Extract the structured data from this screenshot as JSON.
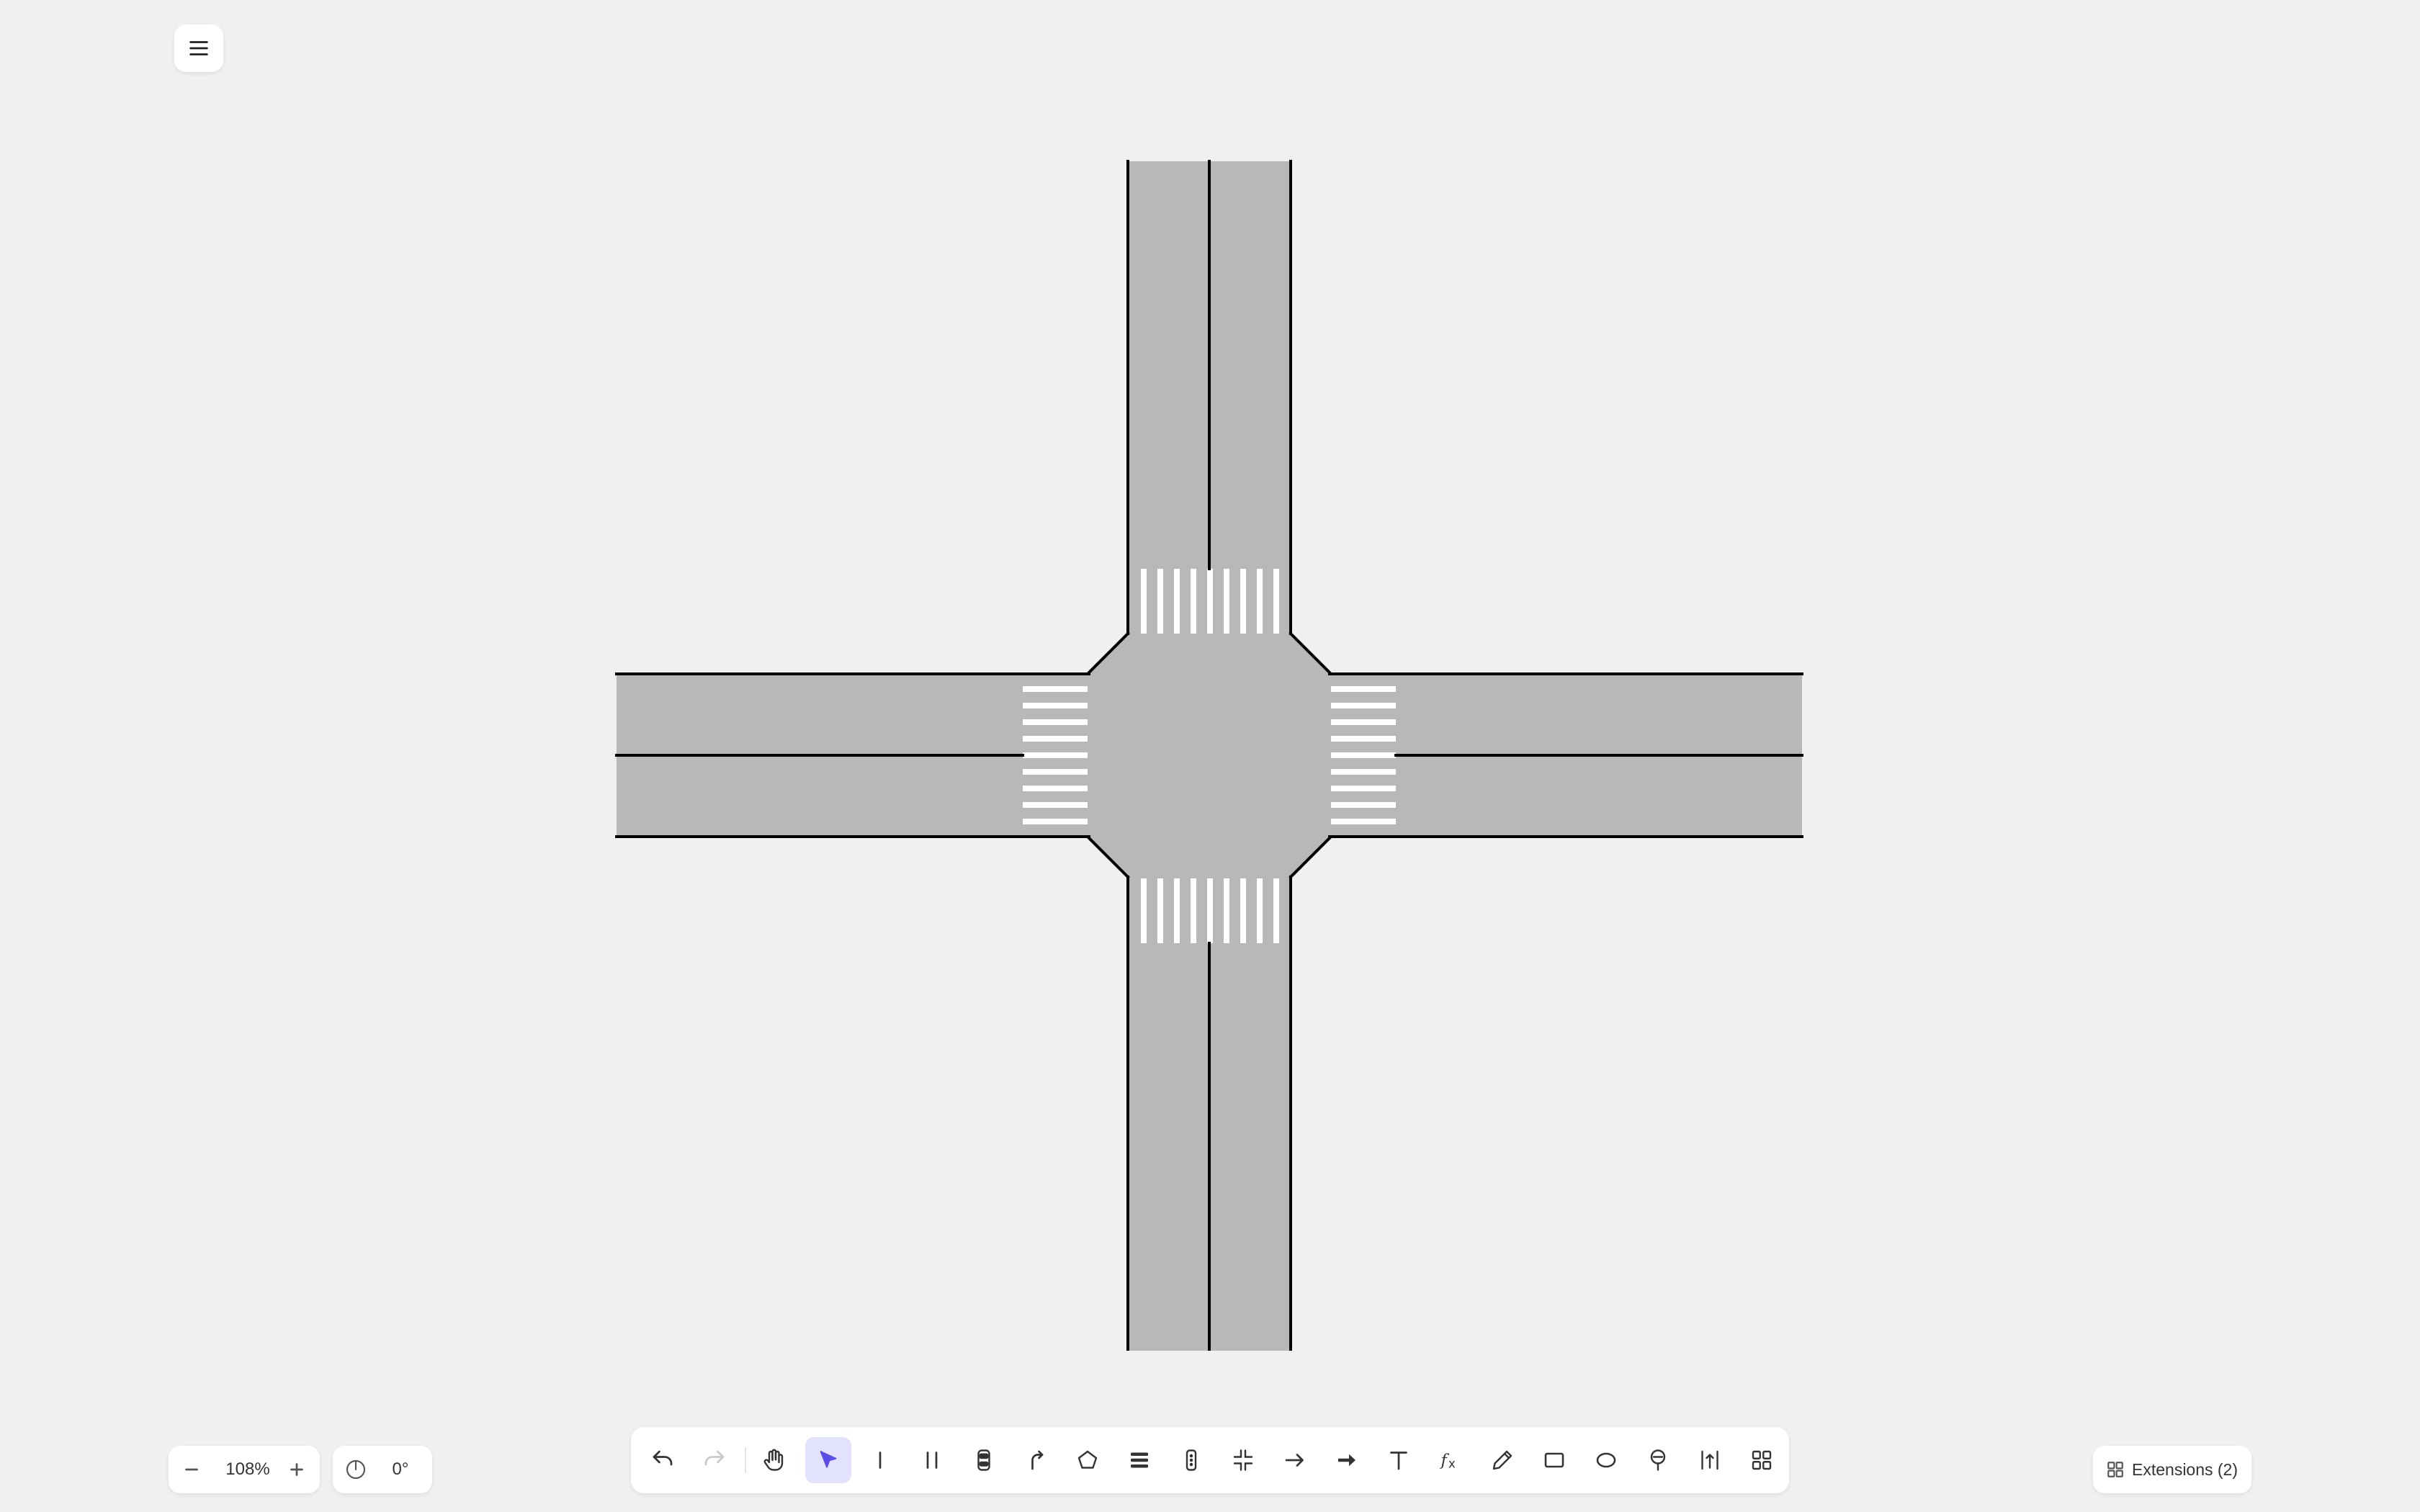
{
  "app": {
    "menu_icon": "hamburger-menu-icon"
  },
  "canvas": {
    "background": "#f0f0f0",
    "road_color": "#b8b8b8",
    "edge_color": "#000000",
    "crosswalk_color": "#ffffff",
    "scene": "four-way intersection with two-lane roads and zebra crosswalks on each approach"
  },
  "zoom": {
    "value": "108%",
    "zoom_out_icon": "minus-icon",
    "zoom_in_icon": "plus-icon"
  },
  "rotation": {
    "value": "0°",
    "icon": "compass-rotate-icon"
  },
  "toolbar": {
    "active_tool": "select",
    "accent": "#5b4ee6",
    "tools": [
      {
        "id": "undo",
        "icon": "undo-icon"
      },
      {
        "id": "redo",
        "icon": "redo-icon",
        "disabled": true
      },
      {
        "id": "hand",
        "icon": "hand-pan-icon"
      },
      {
        "id": "select",
        "icon": "select-arrow-icon"
      },
      {
        "id": "single-line-road",
        "icon": "single-line-road-icon"
      },
      {
        "id": "double-line-road",
        "icon": "double-line-road-icon"
      },
      {
        "id": "vehicle",
        "icon": "car-icon"
      },
      {
        "id": "turn-path",
        "icon": "turn-arrow-icon"
      },
      {
        "id": "polygon",
        "icon": "pentagon-icon"
      },
      {
        "id": "crosswalk",
        "icon": "crosswalk-icon"
      },
      {
        "id": "traffic-light",
        "icon": "traffic-light-icon"
      },
      {
        "id": "intersection",
        "icon": "intersection-icon"
      },
      {
        "id": "thin-arrow",
        "icon": "thin-arrow-icon"
      },
      {
        "id": "thick-arrow",
        "icon": "thick-arrow-icon"
      },
      {
        "id": "text",
        "icon": "text-icon"
      },
      {
        "id": "formula",
        "icon": "formula-icon"
      },
      {
        "id": "pencil",
        "icon": "pencil-icon"
      },
      {
        "id": "rectangle",
        "icon": "rectangle-icon"
      },
      {
        "id": "ellipse",
        "icon": "ellipse-icon"
      },
      {
        "id": "signpost",
        "icon": "signpost-icon"
      },
      {
        "id": "measure",
        "icon": "measure-icon"
      },
      {
        "id": "more",
        "icon": "grid-more-icon"
      }
    ]
  },
  "extensions": {
    "label": "Extensions (2)",
    "icon": "extensions-grid-icon"
  }
}
